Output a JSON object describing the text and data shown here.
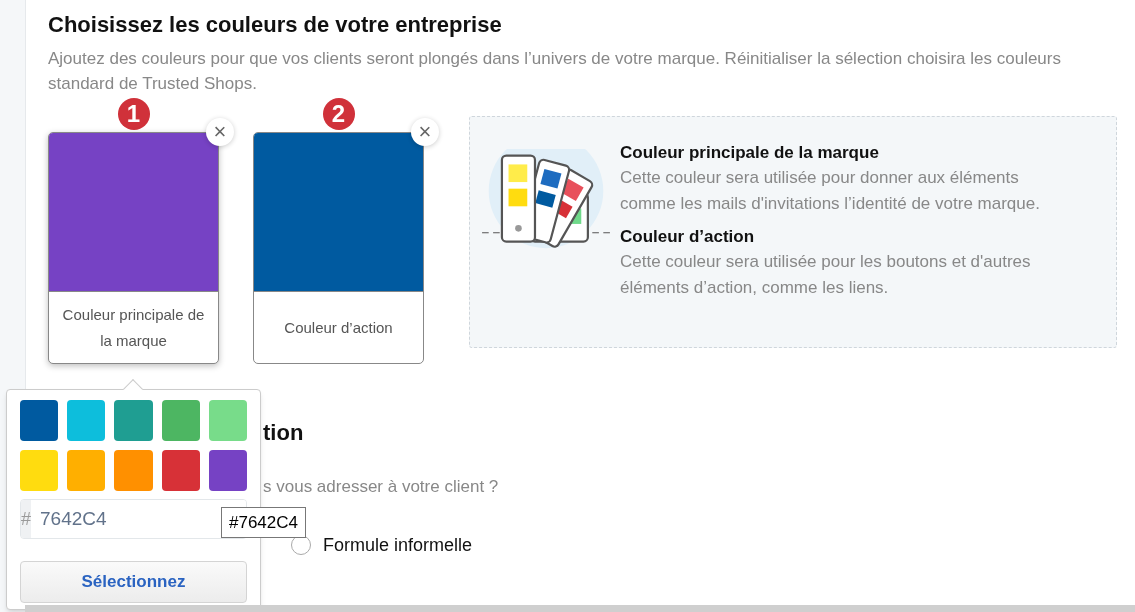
{
  "section": {
    "title": "Choisissez les couleurs de votre entreprise",
    "description": "Ajoutez des couleurs pour que vos clients seront plongés dans l’univers de votre marque. Réinitialiser la sélection choisira les couleurs standard de Trusted Shops."
  },
  "color_cards": [
    {
      "number": "1",
      "label": "Couleur principale de la marque",
      "color": "#7642c4",
      "close": "×",
      "open": true
    },
    {
      "number": "2",
      "label": "Couleur d’action",
      "color": "#005aa0",
      "close": "×",
      "open": false
    }
  ],
  "info": [
    {
      "title": "Couleur principale de la marque",
      "text": "Cette couleur sera utilisée pour donner aux éléments comme les mails d'invitations l’identité de votre marque."
    },
    {
      "title": "Couleur d’action",
      "text": "Cette couleur sera utilisée pour les boutons et d'autres éléments d’action, comme les liens."
    }
  ],
  "lower_section": {
    "title": "tion",
    "question": "s vous adresser à votre client ?",
    "options": [
      {
        "label": "Formule informelle",
        "selected": false
      }
    ]
  },
  "color_picker": {
    "swatches": [
      {
        "color": "#005aa0"
      },
      {
        "color": "#0dbedc"
      },
      {
        "color": "#1f9e92"
      },
      {
        "color": "#4db662"
      },
      {
        "color": "#78dc8a"
      },
      {
        "color": "#ffdc0f"
      },
      {
        "color": "#ffaf00"
      },
      {
        "color": "#ff9000"
      },
      {
        "color": "#d73137"
      },
      {
        "color": "#7642c4"
      }
    ],
    "prefix": "#",
    "value": "7642C4",
    "tooltip": "#7642C4",
    "button": "Sélectionnez"
  }
}
